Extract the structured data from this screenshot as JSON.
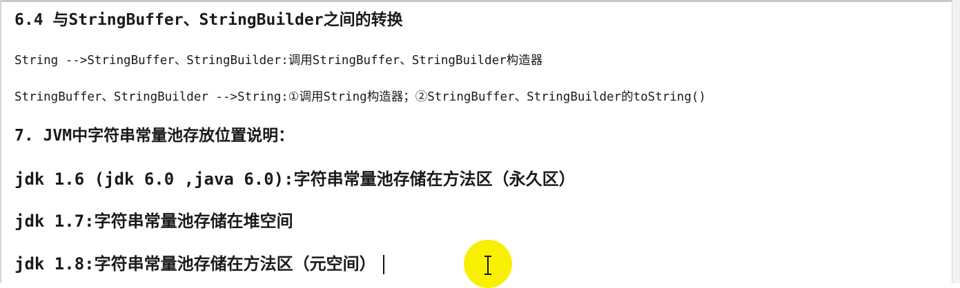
{
  "document": {
    "lines": [
      "6.4 与StringBuffer、StringBuilder之间的转换",
      "String -->StringBuffer、StringBuilder:调用StringBuffer、StringBuilder构造器",
      "StringBuffer、StringBuilder -->String:①调用String构造器；②StringBuffer、StringBuilder的toString()",
      "7. JVM中字符串常量池存放位置说明：",
      "jdk 1.6 (jdk 6.0 ,java 6.0):字符串常量池存储在方法区（永久区）",
      "jdk 1.7:字符串常量池存储在堆空间",
      "jdk 1.8:字符串常量池存储在方法区（元空间）"
    ]
  },
  "overlay": {
    "highlight_color": "#f7f000",
    "cursor_icon": "text-cursor-icon"
  }
}
